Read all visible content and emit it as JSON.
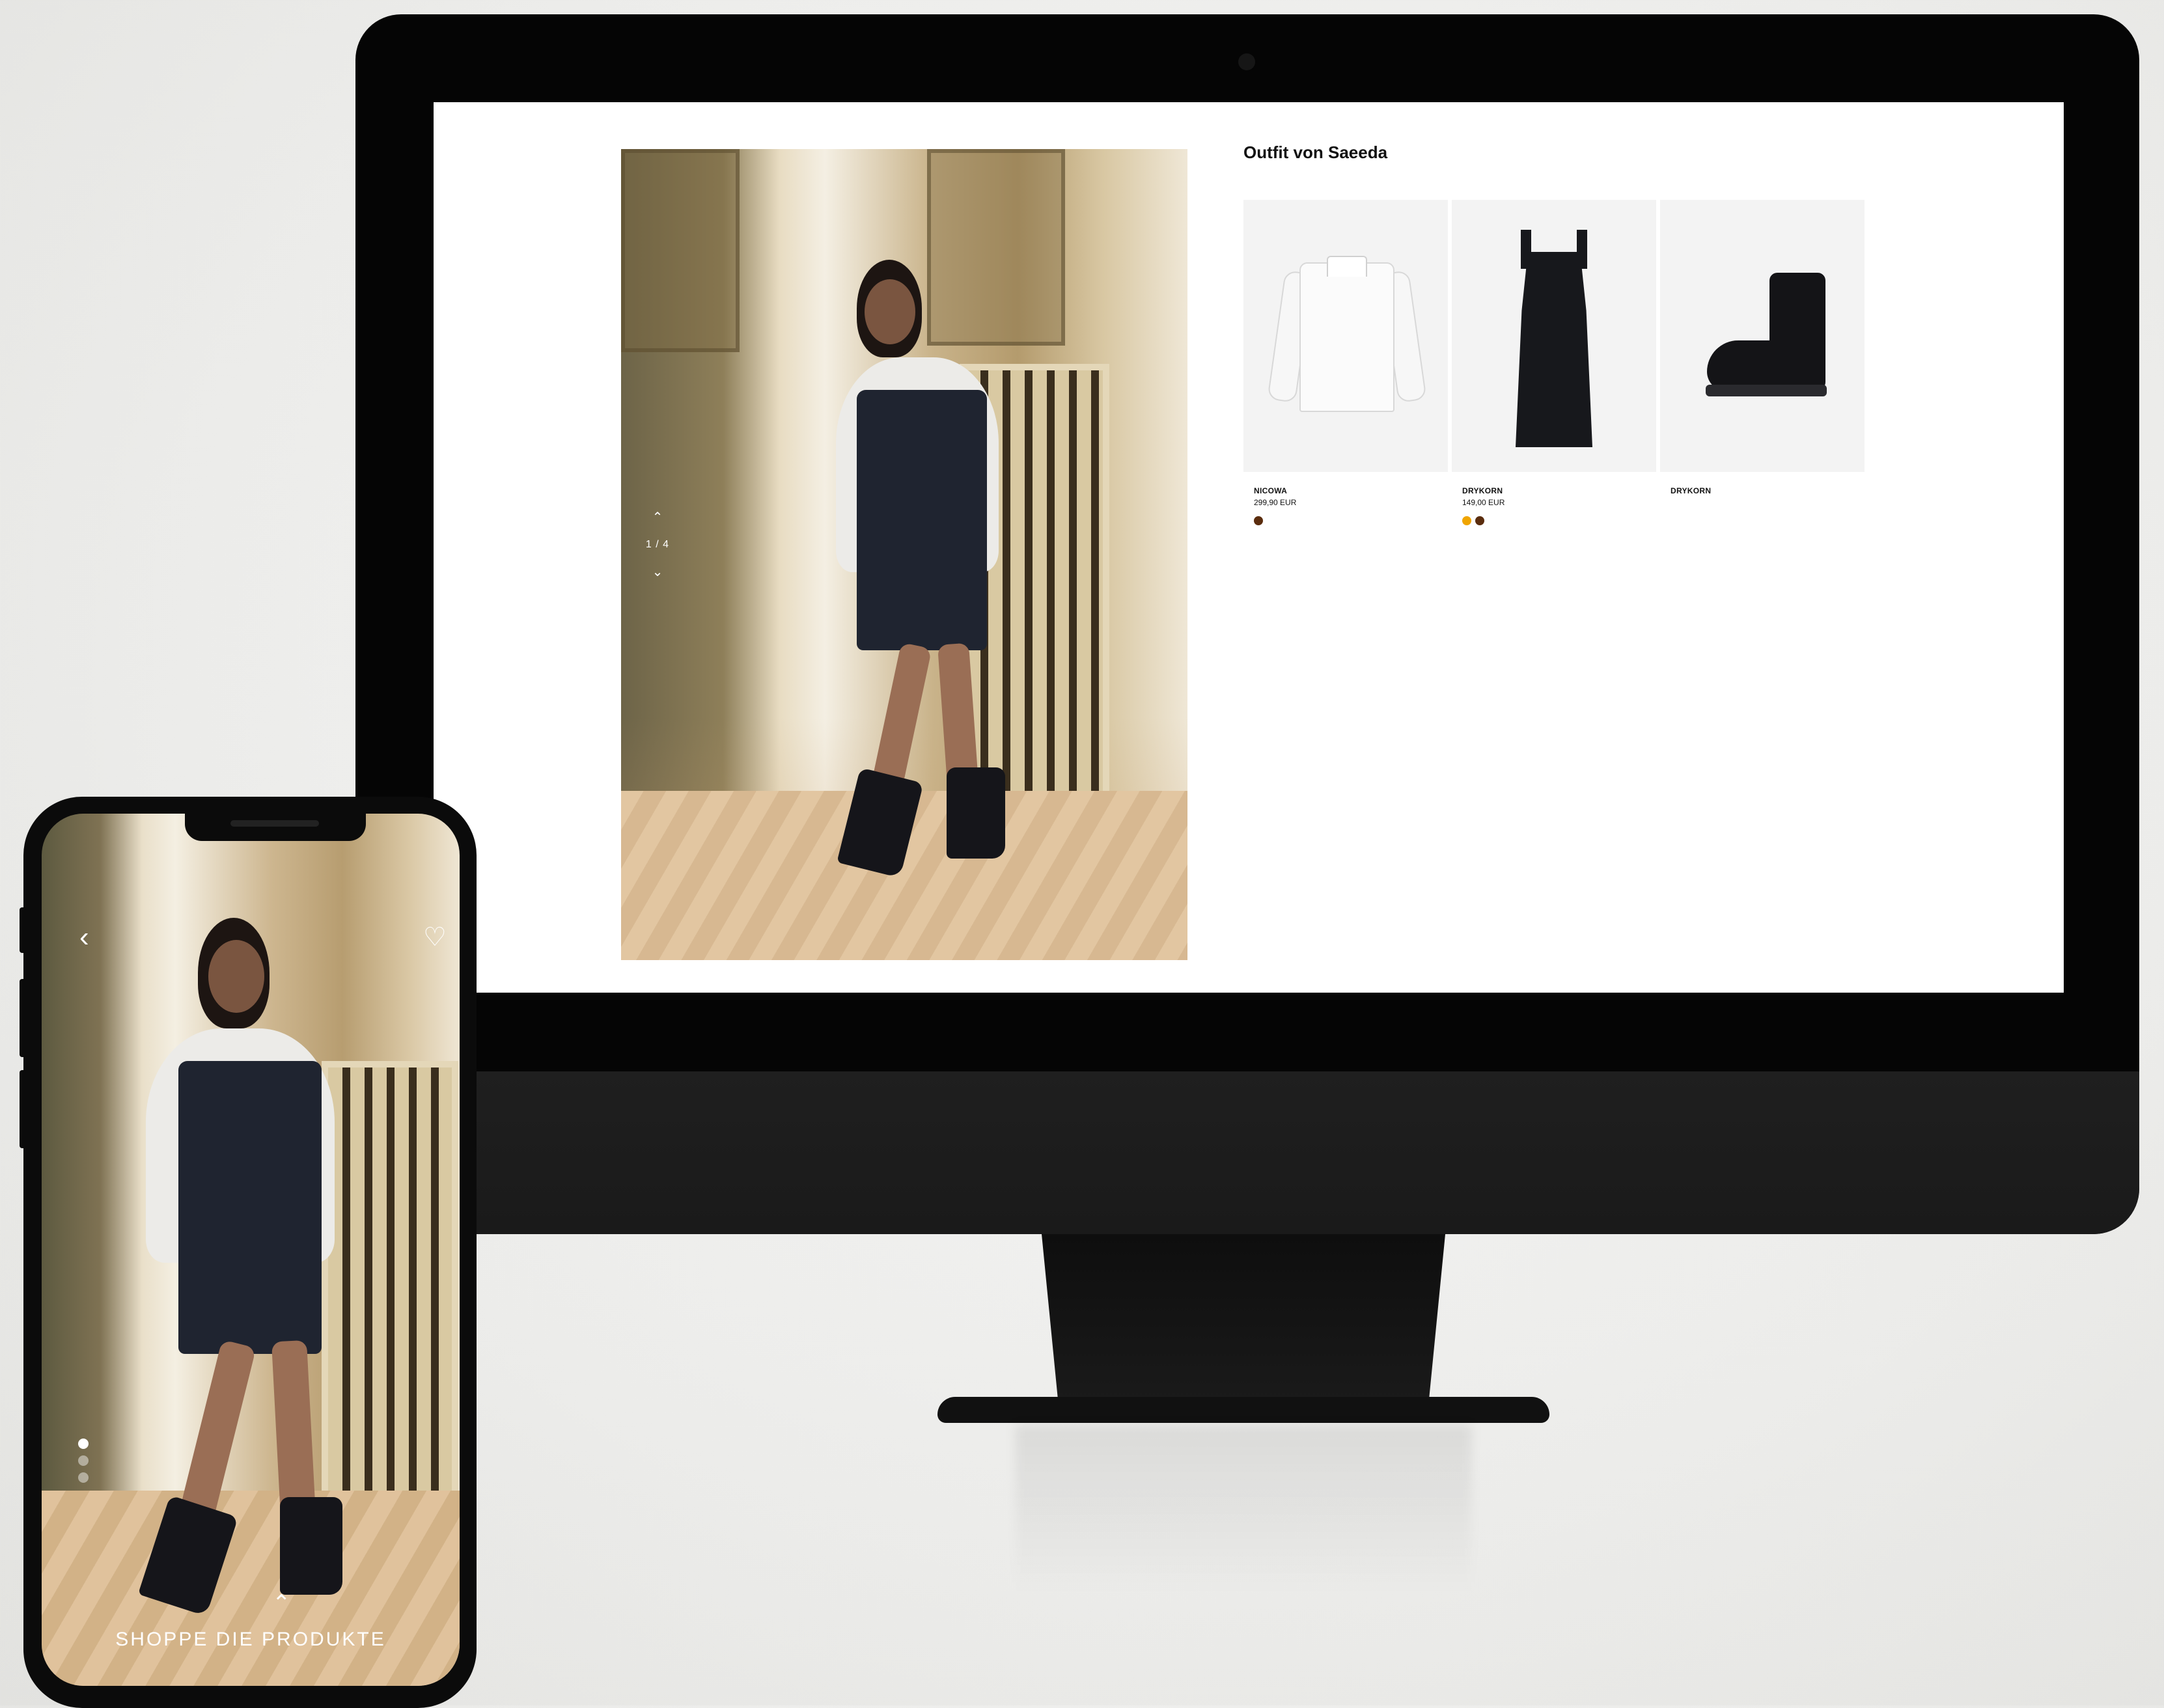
{
  "desktop": {
    "hero": {
      "counter": "1 / 4",
      "up_icon": "chevron-up-icon",
      "down_icon": "chevron-down-icon"
    },
    "outfit_title": "Outfit von Saeeda",
    "products": [
      {
        "brand": "NICOWA",
        "price": "299,90 EUR",
        "swatches": [
          "#5b2d0e"
        ],
        "icon": "shirt-image"
      },
      {
        "brand": "DRYKORN",
        "price": "149,00 EUR",
        "swatches": [
          "#f0a500",
          "#5b2d0e"
        ],
        "icon": "dress-image"
      },
      {
        "brand": "DRYKORN",
        "price": "",
        "swatches": [],
        "icon": "boot-image"
      }
    ]
  },
  "mobile": {
    "back_icon": "chevron-left-icon",
    "favorite_icon": "heart-icon",
    "pager_dots": 3,
    "pager_active": 1,
    "shop_icon": "chevron-up-icon",
    "shop_label": "SHOPPE DIE PRODUKTE"
  },
  "colors": {
    "monitor": "#050505",
    "screen_bg": "#ffffff",
    "product_bg": "#f3f3f3",
    "text": "#111111"
  }
}
